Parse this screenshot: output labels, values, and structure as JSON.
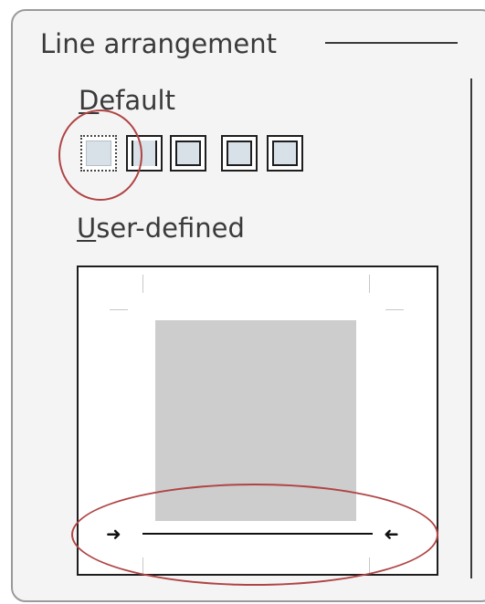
{
  "section": {
    "title": "Line arrangement"
  },
  "default_label": {
    "mnemonic": "D",
    "rest": "efault"
  },
  "user_defined_label": {
    "mnemonic": "U",
    "rest": "ser-defined"
  },
  "presets": [
    {
      "name": "no-borders",
      "selected": true
    },
    {
      "name": "left-and-right-borders"
    },
    {
      "name": "outer-border"
    },
    {
      "name": "outer-border-thick"
    },
    {
      "name": "box-border"
    }
  ],
  "preview": {
    "highlighted_border": "bottom",
    "annotation_color": "#b04444"
  }
}
